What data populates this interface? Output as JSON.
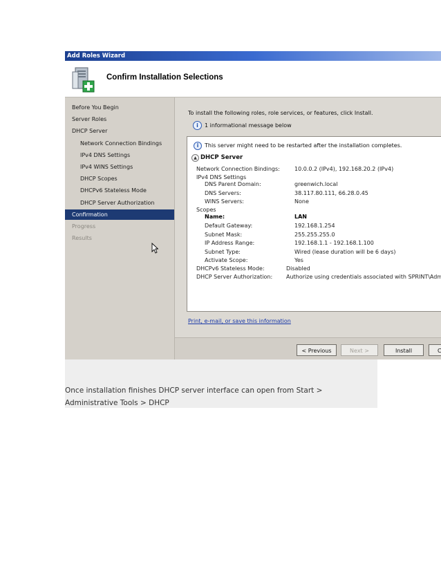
{
  "window": {
    "title": "Add Roles Wizard"
  },
  "header": {
    "heading": "Confirm Installation Selections"
  },
  "nav": {
    "items": [
      {
        "label": "Before You Begin",
        "level": 0,
        "state": "normal"
      },
      {
        "label": "Server Roles",
        "level": 0,
        "state": "normal"
      },
      {
        "label": "DHCP Server",
        "level": 0,
        "state": "normal"
      },
      {
        "label": "Network Connection Bindings",
        "level": 1,
        "state": "normal"
      },
      {
        "label": "IPv4 DNS Settings",
        "level": 1,
        "state": "normal"
      },
      {
        "label": "IPv4 WINS Settings",
        "level": 1,
        "state": "normal"
      },
      {
        "label": "DHCP Scopes",
        "level": 1,
        "state": "normal"
      },
      {
        "label": "DHCPv6 Stateless Mode",
        "level": 1,
        "state": "normal"
      },
      {
        "label": "DHCP Server Authorization",
        "level": 1,
        "state": "normal"
      },
      {
        "label": "Confirmation",
        "level": 0,
        "state": "selected"
      },
      {
        "label": "Progress",
        "level": 0,
        "state": "disabled"
      },
      {
        "label": "Results",
        "level": 0,
        "state": "disabled"
      }
    ]
  },
  "main": {
    "intro": "To install the following roles, role services, or features, click Install.",
    "info_count": "1 informational message below",
    "restart_message": "This server might need to be restarted after the installation completes.",
    "section_title": "DHCP Server",
    "details": {
      "bindings_label": "Network Connection Bindings:",
      "bindings_value": "10.0.0.2 (IPv4), 192.168.20.2 (IPv4)",
      "dns_settings_label": "IPv4 DNS Settings",
      "dns_parent_label": "DNS Parent Domain:",
      "dns_parent_value": "greenwich.local",
      "dns_servers_label": "DNS Servers:",
      "dns_servers_value": "38.117.80.111, 66.28.0.45",
      "wins_label": "WINS Servers:",
      "wins_value": "None",
      "scopes_label": "Scopes",
      "name_label": "Name:",
      "name_value": "LAN",
      "gateway_label": "Default Gateway:",
      "gateway_value": "192.168.1.254",
      "mask_label": "Subnet Mask:",
      "mask_value": "255.255.255.0",
      "range_label": "IP Address Range:",
      "range_value": "192.168.1.1 - 192.168.1.100",
      "subnet_type_label": "Subnet Type:",
      "subnet_type_value": "Wired (lease duration will be 6 days)",
      "activate_label": "Activate Scope:",
      "activate_value": "Yes",
      "stateless_label": "DHCPv6 Stateless Mode:",
      "stateless_value": "Disabled",
      "auth_label": "DHCP Server Authorization:",
      "auth_value": "Authorize using credentials associated with SPRINT\\Adm"
    },
    "print_link": "Print, e-mail, or save this information"
  },
  "buttons": {
    "previous": "< Previous",
    "next": "Next >",
    "install": "Install",
    "cancel": "C"
  },
  "caption": "Once installation finishes DHCP server interface can open from Start > Administrative Tools > DHCP",
  "colors": {
    "titlebar": "#1b3f8f",
    "nav_selected": "#1d3a73",
    "link": "#1838a8"
  }
}
